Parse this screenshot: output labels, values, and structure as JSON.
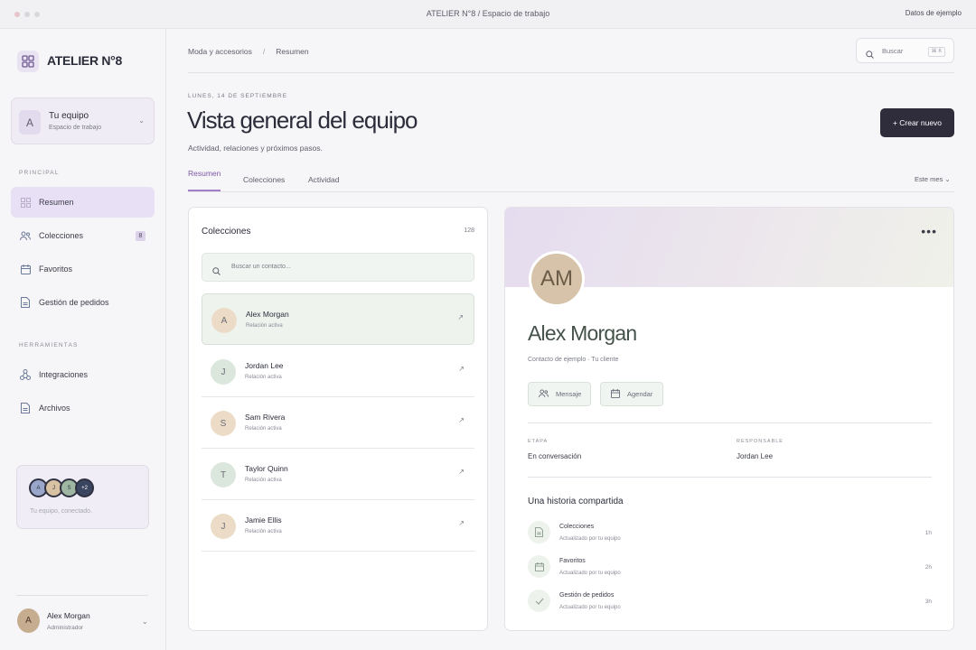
{
  "window": {
    "title": "ATELIER N°8 / Espacio de trabajo",
    "right_label": "Datos de ejemplo"
  },
  "brand": {
    "name": "ATELIER N°8"
  },
  "team_switcher": {
    "initial": "A",
    "name": "Tu equipo",
    "subtitle": "Espacio de trabajo"
  },
  "sidebar": {
    "section_principal": "PRINCIPAL",
    "section_tools": "HERRAMIENTAS",
    "items": [
      {
        "label": "Resumen",
        "icon": "grid-icon",
        "active": true
      },
      {
        "label": "Colecciones",
        "icon": "users-icon",
        "badge": "8"
      },
      {
        "label": "Favoritos",
        "icon": "calendar-icon"
      },
      {
        "label": "Gestión de pedidos",
        "icon": "document-icon"
      }
    ],
    "tools": [
      {
        "label": "Integraciones",
        "icon": "integrations-icon"
      },
      {
        "label": "Archivos",
        "icon": "document-icon"
      }
    ]
  },
  "team_card": {
    "avatars": [
      {
        "initial": "A",
        "color": "#9aa6c9"
      },
      {
        "initial": "J",
        "color": "#d9c2a4"
      },
      {
        "initial": "S",
        "color": "#9fb7a2"
      },
      {
        "initial": "+2",
        "color": "#3a4560"
      }
    ],
    "text": "Tu equipo, conectado."
  },
  "user": {
    "initial": "A",
    "name": "Alex Morgan",
    "role": "Administrador"
  },
  "breadcrumb": {
    "first": "Moda y accesorios",
    "separator": "/",
    "current": "Resumen"
  },
  "search": {
    "placeholder": "Buscar",
    "shortcut": "⌘ K"
  },
  "header": {
    "date": "LUNES, 14 DE SEPTIEMBRE",
    "title": "Vista general del equipo",
    "subtitle": "Actividad, relaciones y próximos pasos.",
    "create_label": "+ Crear nuevo"
  },
  "tabs": [
    {
      "label": "Resumen",
      "active": true
    },
    {
      "label": "Colecciones"
    },
    {
      "label": "Actividad"
    }
  ],
  "period": "Este mes ⌄",
  "collections": {
    "title": "Colecciones",
    "count": "128",
    "search_placeholder": "Buscar un contacto...",
    "rows": [
      {
        "initial": "A",
        "name": "Alex Morgan",
        "status": "Relación activa",
        "color": "#ecdcc7",
        "selected": true
      },
      {
        "initial": "J",
        "name": "Jordan Lee",
        "status": "Relación activa",
        "color": "#dbe6dc"
      },
      {
        "initial": "S",
        "name": "Sam Rivera",
        "status": "Relación activa",
        "color": "#ecdcc7"
      },
      {
        "initial": "T",
        "name": "Taylor Quinn",
        "status": "Relación activa",
        "color": "#dbe6dc"
      },
      {
        "initial": "J",
        "name": "Jamie Ellis",
        "status": "Relación activa",
        "color": "#ecdcc7"
      }
    ]
  },
  "detail": {
    "initials": "AM",
    "name": "Alex Morgan",
    "subtitle": "Contacto de ejemplo · Tu cliente",
    "message_label": "Mensaje",
    "schedule_label": "Agendar",
    "stage_label": "ETAPA",
    "stage_value": "En conversación",
    "owner_label": "RESPONSABLE",
    "owner_value": "Jordan Lee",
    "history_title": "Una historia compartida",
    "history": [
      {
        "name": "Colecciones",
        "sub": "Actualizado por tu equipo",
        "time": "1h",
        "icon": "document-icon"
      },
      {
        "name": "Favoritos",
        "sub": "Actualizado por tu equipo",
        "time": "2h",
        "icon": "calendar-icon"
      },
      {
        "name": "Gestión de pedidos",
        "sub": "Actualizado por tu equipo",
        "time": "3h",
        "icon": "check-icon"
      }
    ]
  }
}
